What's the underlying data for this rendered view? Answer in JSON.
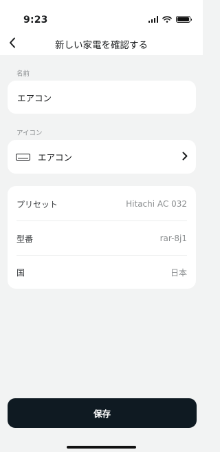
{
  "status": {
    "time": "9:23"
  },
  "nav": {
    "title": "新しい家電を確認する"
  },
  "name_section": {
    "label": "名前",
    "value": "エアコン"
  },
  "icon_section": {
    "label": "アイコン",
    "value": "エアコン",
    "icon": "air-conditioner-icon"
  },
  "details": [
    {
      "key": "プリセット",
      "value": "Hitachi AC 032"
    },
    {
      "key": "型番",
      "value": "rar-8j1"
    },
    {
      "key": "国",
      "value": "日本"
    }
  ],
  "save_label": "保存",
  "colors": {
    "background": "#f2f3f3",
    "card": "#ffffff",
    "primary_button": "#0f1a22",
    "muted_text": "#8a8d8f"
  }
}
